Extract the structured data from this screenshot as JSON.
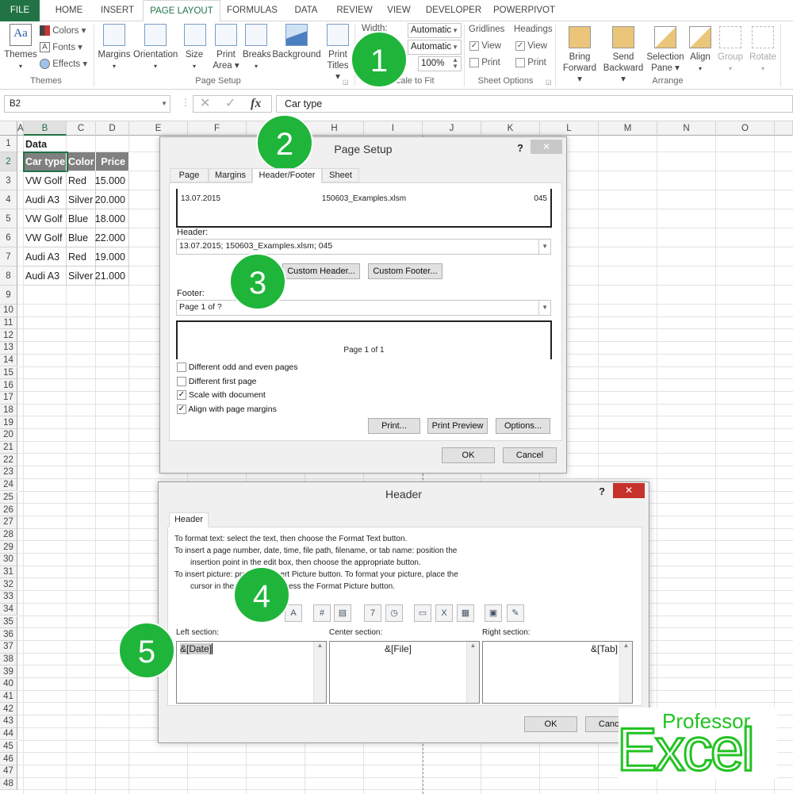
{
  "ribbon": {
    "tabs": [
      "FILE",
      "HOME",
      "INSERT",
      "PAGE LAYOUT",
      "FORMULAS",
      "DATA",
      "REVIEW",
      "VIEW",
      "DEVELOPER",
      "POWERPIVOT"
    ],
    "active_tab": "PAGE LAYOUT",
    "themes_group": {
      "label": "Themes",
      "themes": "Themes",
      "colors": "Colors",
      "fonts": "Fonts",
      "effects": "Effects"
    },
    "page_setup_group": {
      "label": "Page Setup",
      "buttons": [
        [
          "Margins",
          ""
        ],
        [
          "Orientation",
          ""
        ],
        [
          "Size",
          ""
        ],
        [
          "Print",
          "Area"
        ],
        [
          "Breaks",
          ""
        ],
        [
          "Background",
          ""
        ],
        [
          "Print",
          "Titles"
        ]
      ]
    },
    "scale_group": {
      "label": "Scale to Fit",
      "width_label": "Width:",
      "width_value": "Automatic",
      "height_value": "Automatic",
      "scale_value": "100%"
    },
    "sheet_options": {
      "label": "Sheet Options",
      "gridlines": "Gridlines",
      "headings": "Headings",
      "view": "View",
      "print": "Print",
      "gridlines_view": true,
      "gridlines_print": false,
      "headings_view": true,
      "headings_print": false
    },
    "arrange_group": {
      "label": "Arrange",
      "buttons": [
        [
          "Bring",
          "Forward"
        ],
        [
          "Send",
          "Backward"
        ],
        [
          "Selection",
          "Pane"
        ],
        [
          "Align",
          ""
        ],
        [
          "Group",
          ""
        ],
        [
          "Rotate",
          ""
        ]
      ]
    }
  },
  "formula_bar": {
    "name_box": "B2",
    "fx": "fx",
    "value": "Car type"
  },
  "sheet": {
    "columns": [
      "A",
      "B",
      "C",
      "D",
      "E",
      "F",
      "G",
      "H",
      "I",
      "J",
      "K",
      "L",
      "M",
      "N",
      "O"
    ],
    "selected_cell": "B2",
    "title": "Data",
    "headers": [
      "Car type",
      "Color",
      "Price"
    ],
    "rows": [
      [
        "VW Golf",
        "Red",
        "15.000"
      ],
      [
        "Audi A3",
        "Silver",
        "20.000"
      ],
      [
        "VW Golf",
        "Blue",
        "18.000"
      ],
      [
        "VW Golf",
        "Blue",
        "22.000"
      ],
      [
        "Audi A3",
        "Red",
        "19.000"
      ],
      [
        "Audi A3",
        "Silver",
        "21.000"
      ]
    ],
    "row_count": 48
  },
  "page_setup": {
    "title": "Page Setup",
    "help": "?",
    "tabs": [
      "Page",
      "Margins",
      "Header/Footer",
      "Sheet"
    ],
    "active_tab": "Header/Footer",
    "header_preview": {
      "left": "13.07.2015",
      "center": "150603_Examples.xlsm",
      "right": "045"
    },
    "header_label": "Header:",
    "header_value": "13.07.2015; 150603_Examples.xlsm; 045",
    "custom_header": "Custom Header...",
    "custom_footer": "Custom Footer...",
    "footer_label": "Footer:",
    "footer_value": "Page 1 of ?",
    "footer_preview": "Page 1 of 1",
    "checkboxes": [
      {
        "label": "Different odd and even pages",
        "checked": false
      },
      {
        "label": "Different first page",
        "checked": false
      },
      {
        "label": "Scale with document",
        "checked": true
      },
      {
        "label": "Align with page margins",
        "checked": true
      }
    ],
    "print": "Print...",
    "print_preview": "Print Preview",
    "options": "Options...",
    "ok": "OK",
    "cancel": "Cancel"
  },
  "header_dialog": {
    "title": "Header",
    "help": "?",
    "tab": "Header",
    "instructions": [
      "To format text:  select the text, then choose the Format Text button.",
      "To insert a page number, date, time, file path, filename, or tab name:  position the",
      "insertion point in the edit box, then choose the appropriate button.",
      "To insert picture: press the Insert Picture button.  To format your picture, place the",
      "cursor in the edit box and press the Format Picture button."
    ],
    "toolbar_icons": [
      "format-text-icon",
      "page-number-icon",
      "number-of-pages-icon",
      "date-icon",
      "time-icon",
      "file-path-icon",
      "file-name-icon",
      "sheet-name-icon",
      "insert-picture-icon",
      "format-picture-icon"
    ],
    "left_label": "Left section:",
    "center_label": "Center section:",
    "right_label": "Right section:",
    "left_value": "&[Date]",
    "center_value": "&[File]",
    "right_value": "&[Tab]",
    "ok": "OK",
    "cancel": "Cancel"
  },
  "callouts": [
    "1",
    "2",
    "3",
    "4",
    "5"
  ],
  "logo": {
    "line1": "Professor",
    "line2": "Excel"
  },
  "colors": {
    "excel_green": "#217346",
    "callout_green": "#1fb53a",
    "header_fill": "#808080",
    "close_red": "#c7312b"
  }
}
